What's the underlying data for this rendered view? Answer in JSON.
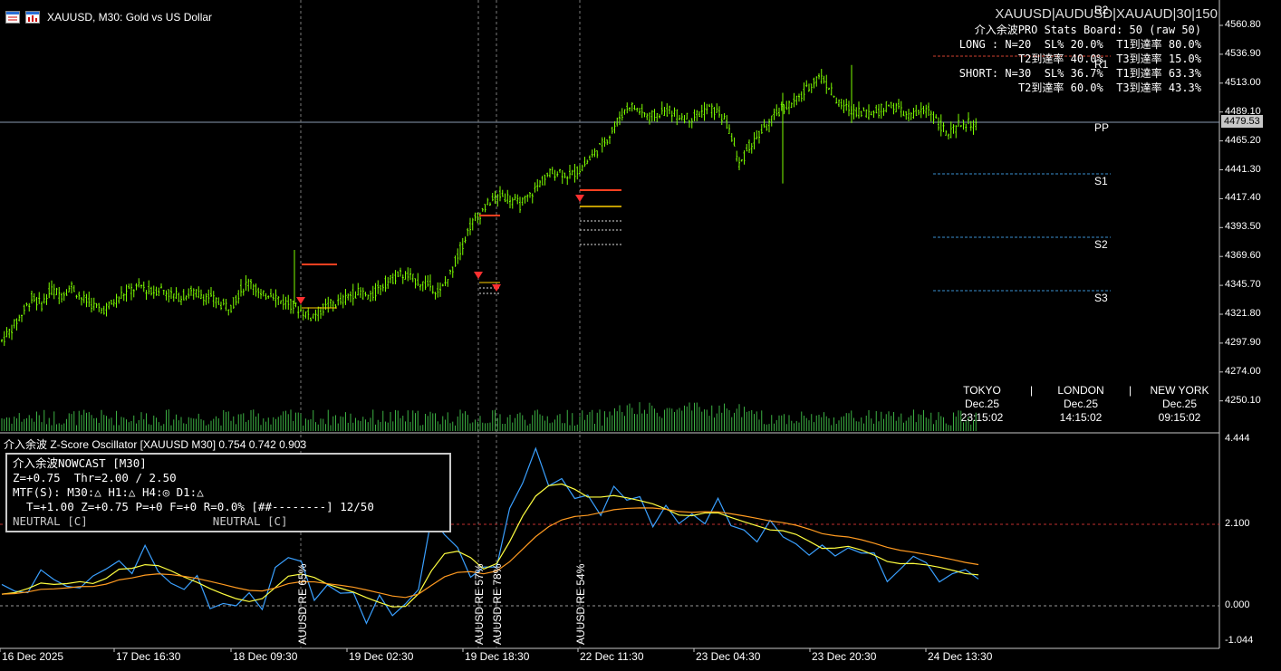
{
  "window": {
    "symbol_title": "XAUUSD, M30:  Gold vs US Dollar"
  },
  "header_symbols": "XAUUSD|AUDUSD|XAUAUD|30|150",
  "stats_board": {
    "line1": "介入余波PRO Stats Board: 50 (raw 50)",
    "line2": "LONG : N=20  SL% 20.0%  T1到達率 80.0%",
    "line3": "T2到達率 40.0%  T3到達率 15.0%",
    "line4": "SHORT: N=30  SL% 36.7%  T1到達率 63.3%",
    "line5": "T2到達率 60.0%  T3到達率 43.3%"
  },
  "pivots": {
    "r2": "R2",
    "r1": "R1",
    "pp": "PP",
    "s1": "S1",
    "s2": "S2",
    "s3": "S3"
  },
  "price_axis": [
    "4560.80",
    "4536.90",
    "4513.00",
    "4489.10",
    "4465.20",
    "4441.30",
    "4417.40",
    "4393.50",
    "4369.60",
    "4345.70",
    "4321.80",
    "4297.90",
    "4274.00",
    "4250.10"
  ],
  "current_price": "4479.53",
  "sessions": [
    {
      "name": "TOKYO",
      "date": "Dec.25",
      "time": "23:15:02"
    },
    {
      "name": "LONDON",
      "date": "Dec.25",
      "time": "14:15:02"
    },
    {
      "name": "NEW YORK",
      "date": "Dec.25",
      "time": "09:15:02"
    }
  ],
  "session_separator": "|",
  "oscillator": {
    "title": "介入余波 Z-Score Oscillator [XAUUSD M30] 0.754 0.742 0.903",
    "axis": [
      "4.444",
      "2.100",
      "0.000",
      "-1.044"
    ]
  },
  "nowcast": {
    "line1": "介入余波NOWCAST [M30]",
    "line2": "Z=+0.75  Thr=2.00 / 2.50",
    "line3": "MTF(S): M30:△ H1:△ H4:◎ D1:△",
    "line4": "  T=+1.00 Z=+0.75 P=+0 F=+0 R=0.0% [##--------] 12/50",
    "line5_left": "NEUTRAL [C]",
    "line5_right": "NEUTRAL [C]"
  },
  "event_labels": [
    "AUUSD RE 65%",
    "AUUSD RE 57%",
    "AUUSD RE 78%",
    "AUUSD RE 54%"
  ],
  "time_axis": [
    "16 Dec 2025",
    "17 Dec 16:30",
    "18 Dec 09:30",
    "19 Dec 02:30",
    "19 Dec 18:30",
    "22 Dec 11:30",
    "23 Dec 04:30",
    "23 Dec 20:30",
    "24 Dec 13:30"
  ],
  "chart_data": {
    "type": "candlestick",
    "symbol": "XAUUSD",
    "timeframe": "M30",
    "ylim": [
      4238,
      4572
    ],
    "close_series": [
      4300,
      4310,
      4322,
      4335,
      4330,
      4342,
      4338,
      4345,
      4335,
      4330,
      4325,
      4330,
      4338,
      4342,
      4345,
      4340,
      4343,
      4338,
      4336,
      4340,
      4338,
      4335,
      4330,
      4328,
      4342,
      4350,
      4336,
      4340,
      4333,
      4330,
      4325,
      4320,
      4325,
      4330,
      4332,
      4338,
      4340,
      4335,
      4345,
      4350,
      4355,
      4352,
      4348,
      4345,
      4340,
      4355,
      4375,
      4395,
      4405,
      4415,
      4420,
      4418,
      4412,
      4420,
      4430,
      4438,
      4440,
      4436,
      4442,
      4450,
      4460,
      4470,
      4485,
      4495,
      4490,
      4485,
      4488,
      4490,
      4486,
      4484,
      4488,
      4492,
      4488,
      4475,
      4445,
      4460,
      4470,
      4480,
      4490,
      4495,
      4500,
      4510,
      4520,
      4510,
      4495,
      4492,
      4490,
      4488,
      4490,
      4495,
      4492,
      4485,
      4488,
      4492,
      4480,
      4470,
      4478,
      4480,
      4478
    ],
    "oscillator_z": [
      0.3,
      0.4,
      0.6,
      0.8,
      0.5,
      0.6,
      0.7,
      0.5,
      0.9,
      1.3,
      1.0,
      1.2,
      1.0,
      0.7,
      0.5,
      0.4,
      0.2,
      0.1,
      0.0,
      0.0,
      0.3,
      0.9,
      1.2,
      0.9,
      0.6,
      0.3,
      0.3,
      0.2,
      0.0,
      -0.1,
      -0.2,
      0.0,
      0.8,
      1.8,
      2.0,
      1.5,
      1.0,
      0.5,
      1.3,
      2.5,
      3.3,
      3.6,
      3.5,
      3.2,
      2.8,
      2.5,
      2.8,
      2.9,
      2.7,
      2.6,
      2.5,
      2.3,
      2.1,
      2.3,
      2.5,
      2.4,
      2.1,
      2.0,
      1.9,
      1.8,
      1.9,
      1.7,
      1.4,
      1.2,
      1.5,
      1.6,
      1.3,
      1.1,
      0.9,
      1.0,
      1.1,
      1.0,
      0.9,
      0.8,
      0.7,
      0.75
    ],
    "zero_line": 0.0,
    "threshold": 2.1
  }
}
